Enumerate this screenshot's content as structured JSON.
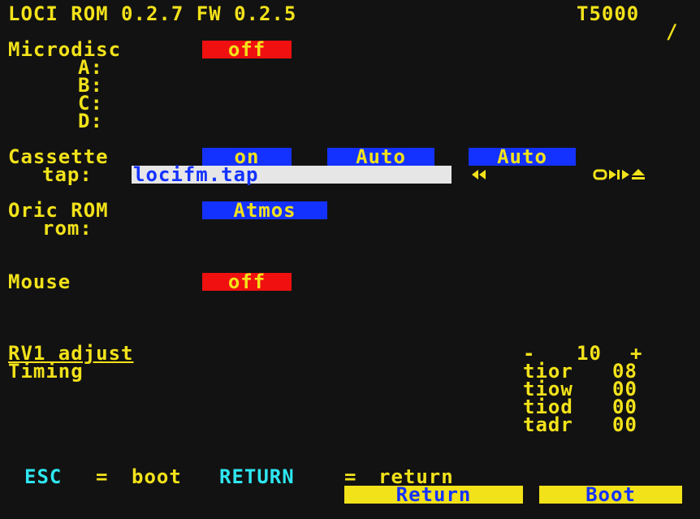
{
  "header": {
    "title": "LOCI ROM 0.2.7 FW 0.2.5",
    "time": "T5000",
    "activity_indicator": "/"
  },
  "microdisc": {
    "label": "Microdisc",
    "status": "off",
    "drives": [
      "A:",
      "B:",
      "C:",
      "D:"
    ]
  },
  "cassette": {
    "label": "Cassette",
    "status": "on",
    "mode1": "Auto",
    "mode2": "Auto",
    "tap_label": "tap:",
    "tap_file": "locifm.tap",
    "rewind_icon": "rewind-icon",
    "controls_icon": "tape-controls-icon"
  },
  "oric_rom": {
    "label": "Oric ROM",
    "value": "Atmos",
    "rom_label": "rom:"
  },
  "mouse": {
    "label": "Mouse",
    "status": "off"
  },
  "rv1": {
    "label": "RV1 adjust",
    "minus": "-",
    "value": "10",
    "plus": "+"
  },
  "timing": {
    "label": "Timing",
    "rows": [
      {
        "name": "tior",
        "value": "08"
      },
      {
        "name": "tiow",
        "value": "00"
      },
      {
        "name": "tiod",
        "value": "00"
      },
      {
        "name": "tadr",
        "value": "00"
      }
    ]
  },
  "footer": {
    "esc_key": "ESC",
    "eq1": "=",
    "boot_word": "boot",
    "return_key": "RETURN",
    "eq2": "=",
    "return_word": "return",
    "return_button": "Return",
    "boot_button": "Boot"
  },
  "colors": {
    "background": "#121212",
    "text": "#f2e21a",
    "off": "#f01010",
    "on": "#1432ff",
    "cyan": "#2ee6f0",
    "input_bg": "#e6e6e6"
  }
}
